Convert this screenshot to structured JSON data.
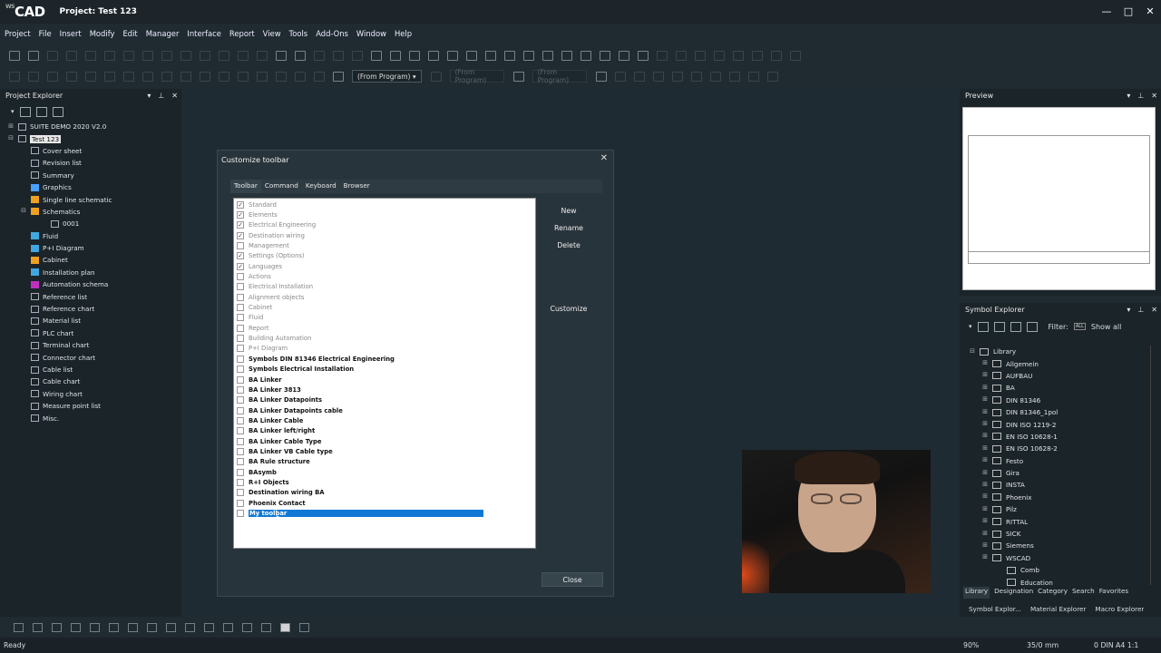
{
  "app": {
    "logo": "CAD",
    "logo_prefix": "WS",
    "title": "Project: Test 123"
  },
  "window_controls": [
    "—",
    "□",
    "✕"
  ],
  "menu": [
    "Project",
    "File",
    "Insert",
    "Modify",
    "Edit",
    "Manager",
    "Interface",
    "Report",
    "View",
    "Tools",
    "Add-Ons",
    "Window",
    "Help"
  ],
  "toolbar2": {
    "from_program": "(From Program)",
    "from_program2": "(From Program)",
    "from_program3": "(From Program)"
  },
  "project_explorer": {
    "title": "Project Explorer",
    "items": [
      {
        "label": "SUITE DEMO 2020 V2.0",
        "level": 0,
        "toggle": "⊞",
        "icon": "project-icon"
      },
      {
        "label": "Test 123",
        "level": 0,
        "toggle": "⊟",
        "icon": "project-icon",
        "selected": true
      },
      {
        "label": "Cover sheet",
        "level": 1,
        "icon": "page-icon"
      },
      {
        "label": "Revision list",
        "level": 1,
        "icon": "list-icon"
      },
      {
        "label": "Summary",
        "level": 1,
        "icon": "list-icon"
      },
      {
        "label": "Graphics",
        "level": 1,
        "icon": "graphics-icon"
      },
      {
        "label": "Single line schematic",
        "level": 1,
        "icon": "schematic-icon"
      },
      {
        "label": "Schematics",
        "level": 1,
        "toggle": "⊟",
        "icon": "schematic-icon"
      },
      {
        "label": "0001",
        "level": 2,
        "icon": "page-icon"
      },
      {
        "label": "Fluid",
        "level": 1,
        "icon": "fluid-icon"
      },
      {
        "label": "P+I Diagram",
        "level": 1,
        "icon": "pid-icon"
      },
      {
        "label": "Cabinet",
        "level": 1,
        "icon": "cabinet-icon"
      },
      {
        "label": "Installation plan",
        "level": 1,
        "icon": "installation-icon"
      },
      {
        "label": "Automation schema",
        "level": 1,
        "icon": "automation-icon"
      },
      {
        "label": "Reference list",
        "level": 1,
        "icon": "list-icon"
      },
      {
        "label": "Reference chart",
        "level": 1,
        "icon": "list-icon"
      },
      {
        "label": "Material list",
        "level": 1,
        "icon": "list-icon"
      },
      {
        "label": "PLC chart",
        "level": 1,
        "icon": "list-icon"
      },
      {
        "label": "Terminal chart",
        "level": 1,
        "icon": "list-icon"
      },
      {
        "label": "Connector chart",
        "level": 1,
        "icon": "list-icon"
      },
      {
        "label": "Cable list",
        "level": 1,
        "icon": "list-icon"
      },
      {
        "label": "Cable chart",
        "level": 1,
        "icon": "list-icon"
      },
      {
        "label": "Wiring chart",
        "level": 1,
        "icon": "list-icon"
      },
      {
        "label": "Measure point list",
        "level": 1,
        "icon": "list-icon"
      },
      {
        "label": "Misc.",
        "level": 1,
        "icon": "misc-icon"
      }
    ],
    "colors": {
      "fluid": "#3fa8e0",
      "pid": "#3fa8e0",
      "cabinet": "#f0a020",
      "installation": "#3fa8e0",
      "automation": "#c030c0",
      "schematic": "#f0a020",
      "graphics": "#4aa0ff"
    }
  },
  "dialog": {
    "title": "Customize toolbar",
    "close_icon": "✕",
    "tabs": [
      "Toolbar",
      "Command",
      "Keyboard",
      "Browser"
    ],
    "active_tab": 0,
    "toolbars": [
      {
        "label": "Standard",
        "checked": true,
        "bold": false
      },
      {
        "label": "Elements",
        "checked": true,
        "bold": false
      },
      {
        "label": "Electrical Engineering",
        "checked": true,
        "bold": false
      },
      {
        "label": "Destination wiring",
        "checked": true,
        "bold": false
      },
      {
        "label": "Management",
        "checked": false,
        "bold": false
      },
      {
        "label": "Settings (Options)",
        "checked": true,
        "bold": false
      },
      {
        "label": "Languages",
        "checked": true,
        "bold": false
      },
      {
        "label": "Actions",
        "checked": false,
        "bold": false
      },
      {
        "label": "Electrical Installation",
        "checked": false,
        "bold": false
      },
      {
        "label": "Alignment objects",
        "checked": false,
        "bold": false
      },
      {
        "label": "Cabinet",
        "checked": false,
        "bold": false
      },
      {
        "label": "Fluid",
        "checked": false,
        "bold": false
      },
      {
        "label": "Report",
        "checked": false,
        "bold": false
      },
      {
        "label": "Building Automation",
        "checked": false,
        "bold": false
      },
      {
        "label": "P+I Diagram",
        "checked": false,
        "bold": false
      },
      {
        "label": "Symbols DIN 81346 Electrical Engineering",
        "checked": false,
        "bold": true
      },
      {
        "label": "Symbols Electrical Installation",
        "checked": false,
        "bold": true
      },
      {
        "label": "BA Linker",
        "checked": false,
        "bold": true
      },
      {
        "label": "BA Linker 3813",
        "checked": false,
        "bold": true
      },
      {
        "label": "BA Linker Datapoints",
        "checked": false,
        "bold": true
      },
      {
        "label": "BA Linker Datapoints cable",
        "checked": false,
        "bold": true
      },
      {
        "label": "BA Linker Cable",
        "checked": false,
        "bold": true
      },
      {
        "label": "BA Linker left/right",
        "checked": false,
        "bold": true
      },
      {
        "label": "BA Linker Cable Type",
        "checked": false,
        "bold": true
      },
      {
        "label": "BA Linker VB Cable type",
        "checked": false,
        "bold": true
      },
      {
        "label": "BA Rule structure",
        "checked": false,
        "bold": true
      },
      {
        "label": "BAsymb",
        "checked": false,
        "bold": true
      },
      {
        "label": "R+I Objects",
        "checked": false,
        "bold": true
      },
      {
        "label": "Destination wiring BA",
        "checked": false,
        "bold": true
      },
      {
        "label": "Phoenix Contact",
        "checked": false,
        "bold": true
      },
      {
        "label": "My toolbar",
        "checked": false,
        "bold": true,
        "selected": true
      }
    ],
    "buttons": {
      "new": "New",
      "rename": "Rename",
      "delete": "Delete",
      "customize": "Customize",
      "close": "Close"
    },
    "selection_color": "#0f78d7"
  },
  "preview": {
    "title": "Preview"
  },
  "symbol_explorer": {
    "title": "Symbol Explorer",
    "filter_label": "Filter:",
    "filter_value": "Show all",
    "filter_badge": "ALL",
    "root": "Library",
    "items": [
      "Allgemein",
      "AUFBAU",
      "BA",
      "DIN 81346",
      "DIN 81346_1pol",
      "DIN ISO 1219-2",
      "EN ISO 10628-1",
      "EN ISO 10628-2",
      "Festo",
      "Gira",
      "INSTA",
      "Phoenix",
      "Pilz",
      "RITTAL",
      "SICK",
      "Siemens",
      "WSCAD"
    ],
    "subitems": [
      "Comb",
      "Education"
    ],
    "tabs": [
      "Library",
      "Designation",
      "Category",
      "Search",
      "Favorites"
    ],
    "bottom_tabs": [
      "Symbol Explor...",
      "Material Explorer",
      "Macro Explorer"
    ]
  },
  "status": {
    "left": "Ready",
    "zoom": "90%",
    "coords": "35/0 mm",
    "sheet": "0 DIN A4 1:1"
  }
}
